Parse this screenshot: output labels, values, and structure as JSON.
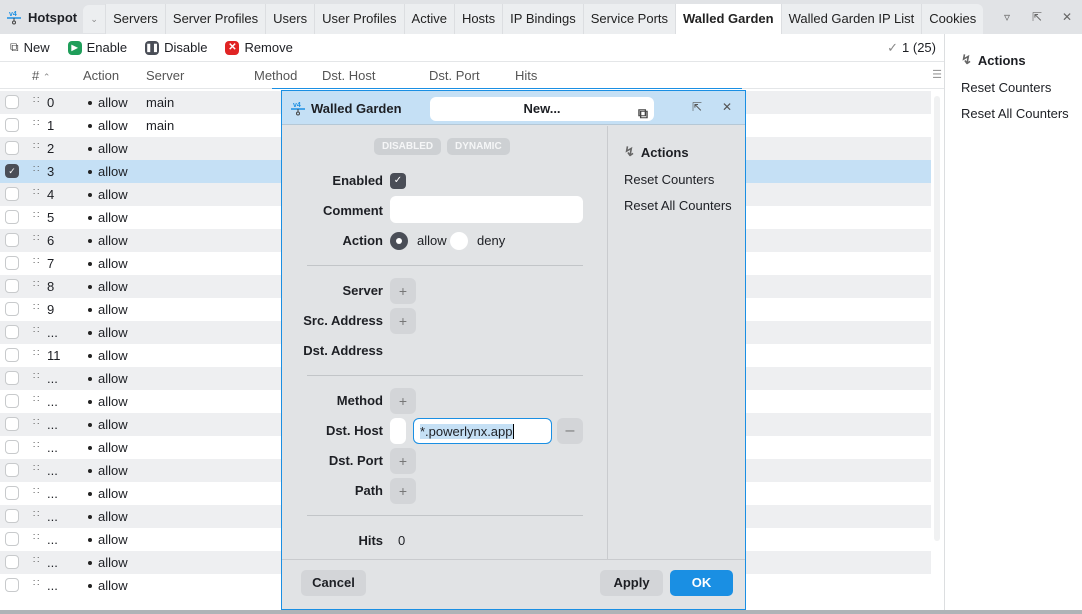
{
  "app": {
    "title": "Hotspot",
    "icon": "network-icon"
  },
  "tabs": [
    {
      "label": "Servers",
      "active": false
    },
    {
      "label": "Server Profiles",
      "active": false
    },
    {
      "label": "Users",
      "active": false
    },
    {
      "label": "User Profiles",
      "active": false
    },
    {
      "label": "Active",
      "active": false
    },
    {
      "label": "Hosts",
      "active": false
    },
    {
      "label": "IP Bindings",
      "active": false
    },
    {
      "label": "Service Ports",
      "active": false
    },
    {
      "label": "Walled Garden",
      "active": true
    },
    {
      "label": "Walled Garden IP List",
      "active": false
    },
    {
      "label": "Cookies",
      "active": false
    }
  ],
  "window_controls": [
    "filter-icon",
    "expand-icon",
    "close-icon"
  ],
  "toolbar": {
    "new_label": "New",
    "enable_label": "Enable",
    "disable_label": "Disable",
    "remove_label": "Remove",
    "selection_count": "1 (25)"
  },
  "colors": {
    "enable": "#1f9e5a",
    "disable": "#4a4e57",
    "remove": "#e02424",
    "accent": "#1a8fe3",
    "selected_row": "#c5e0f5"
  },
  "table": {
    "columns": [
      "#",
      "Action",
      "Server",
      "Method",
      "Dst. Host",
      "Dst. Port",
      "Hits"
    ],
    "rows": [
      {
        "num": "0",
        "action": "allow",
        "server": "main",
        "selected": false
      },
      {
        "num": "1",
        "action": "allow",
        "server": "main",
        "selected": false
      },
      {
        "num": "2",
        "action": "allow",
        "server": "",
        "selected": false
      },
      {
        "num": "3",
        "action": "allow",
        "server": "",
        "selected": true
      },
      {
        "num": "4",
        "action": "allow",
        "server": "",
        "selected": false
      },
      {
        "num": "5",
        "action": "allow",
        "server": "",
        "selected": false
      },
      {
        "num": "6",
        "action": "allow",
        "server": "",
        "selected": false
      },
      {
        "num": "7",
        "action": "allow",
        "server": "",
        "selected": false
      },
      {
        "num": "8",
        "action": "allow",
        "server": "",
        "selected": false
      },
      {
        "num": "9",
        "action": "allow",
        "server": "",
        "selected": false
      },
      {
        "num": "...",
        "action": "allow",
        "server": "",
        "selected": false
      },
      {
        "num": "11",
        "action": "allow",
        "server": "",
        "selected": false
      },
      {
        "num": "...",
        "action": "allow",
        "server": "",
        "selected": false
      },
      {
        "num": "...",
        "action": "allow",
        "server": "",
        "selected": false
      },
      {
        "num": "...",
        "action": "allow",
        "server": "",
        "selected": false
      },
      {
        "num": "...",
        "action": "allow",
        "server": "",
        "selected": false
      },
      {
        "num": "...",
        "action": "allow",
        "server": "",
        "selected": false
      },
      {
        "num": "...",
        "action": "allow",
        "server": "",
        "selected": false
      },
      {
        "num": "...",
        "action": "allow",
        "server": "",
        "selected": false
      },
      {
        "num": "...",
        "action": "allow",
        "server": "",
        "selected": false
      },
      {
        "num": "...",
        "action": "allow",
        "server": "",
        "selected": false
      },
      {
        "num": "...",
        "action": "allow",
        "server": "",
        "selected": false
      }
    ]
  },
  "side_panel": {
    "title": "Actions",
    "items": [
      "Reset Counters",
      "Reset All Counters"
    ]
  },
  "dialog": {
    "title": "Walled Garden",
    "name": "New...",
    "badges": [
      "DISABLED",
      "DYNAMIC"
    ],
    "fields": {
      "enabled_label": "Enabled",
      "enabled": true,
      "comment_label": "Comment",
      "comment_value": "",
      "action_label": "Action",
      "action_options": [
        "allow",
        "deny"
      ],
      "action_selected": "allow",
      "server_label": "Server",
      "src_address_label": "Src. Address",
      "dst_address_label": "Dst. Address",
      "method_label": "Method",
      "dst_host_label": "Dst. Host",
      "dst_host_value": "*.powerlynx.app",
      "dst_port_label": "Dst. Port",
      "path_label": "Path",
      "hits_label": "Hits",
      "hits_value": "0"
    },
    "side": {
      "title": "Actions",
      "items": [
        "Reset Counters",
        "Reset All Counters"
      ]
    },
    "buttons": {
      "cancel": "Cancel",
      "apply": "Apply",
      "ok": "OK"
    }
  }
}
